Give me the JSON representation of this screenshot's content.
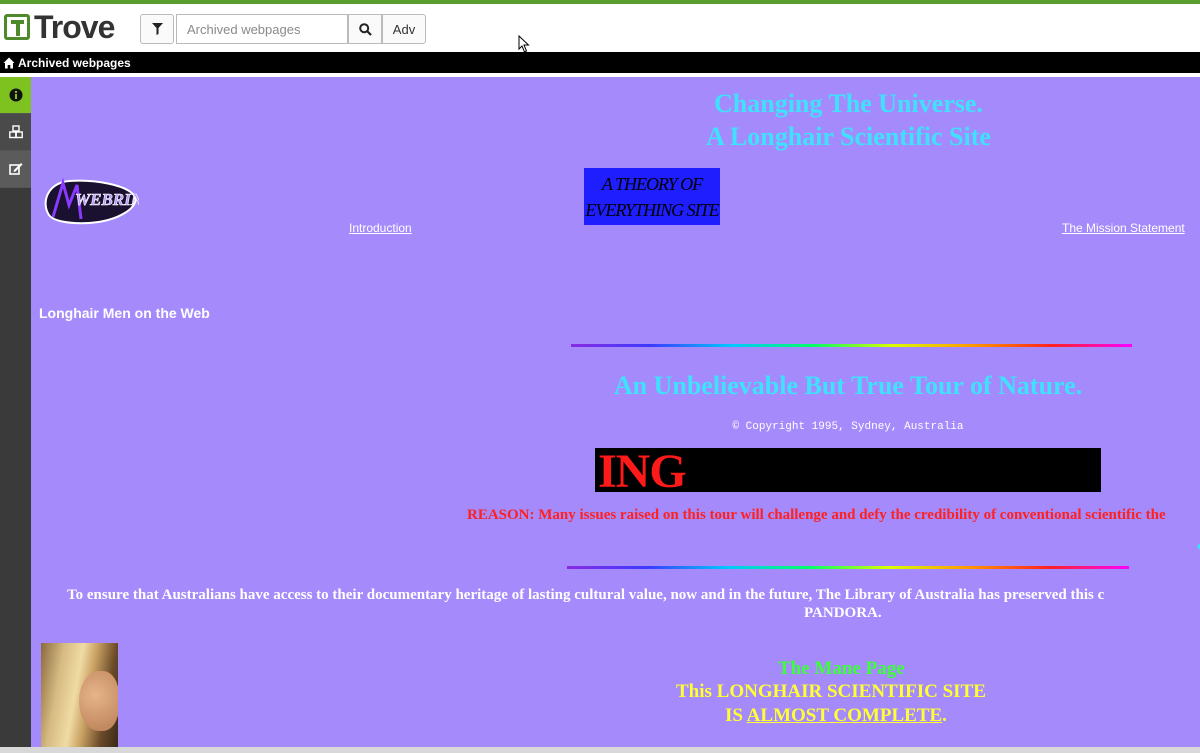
{
  "app": {
    "name": "Trove"
  },
  "search": {
    "placeholder": "Archived webpages",
    "adv_label": "Adv"
  },
  "breadcrumb": {
    "label": "Archived webpages"
  },
  "archived_page": {
    "title_line1": "Changing The Universe.",
    "title_line2": "A Longhair Scientific Site",
    "webring_label": "WEBRING",
    "theory_box_line1": "A THEORY OF",
    "theory_box_line2": "EVERYTHING SITE",
    "link_introduction": "Introduction",
    "link_mission": "The Mission Statement",
    "longhair_men": "Longhair Men on the Web",
    "tour_heading": "An Unbelievable But True Tour of Nature.",
    "copyright": "© Copyright 1995, Sydney, Australia",
    "marquee_text": "ING",
    "reason_text": "REASON: Many issues raised on this tour will challenge and defy the credibility of conventional scientific the",
    "pandora_line1": "To ensure that Australians have access to their documentary heritage of lasting cultural value, now and in the future, The Library of Australia has preserved this c",
    "pandora_line2": "PANDORA.",
    "mane_page": "The Mane Page",
    "complete_line1": "This LONGHAIR SCIENTIFIC SITE",
    "complete_line2_prefix": "IS ",
    "complete_line2_link": "ALMOST COMPLETE",
    "complete_line2_suffix": "."
  },
  "colors": {
    "page_background": "#a58afc",
    "title_cyan": "#40e0ff",
    "reason_red": "#ff2020",
    "sidebar_active": "#7dc21e",
    "trove_green": "#5a9e2f"
  }
}
